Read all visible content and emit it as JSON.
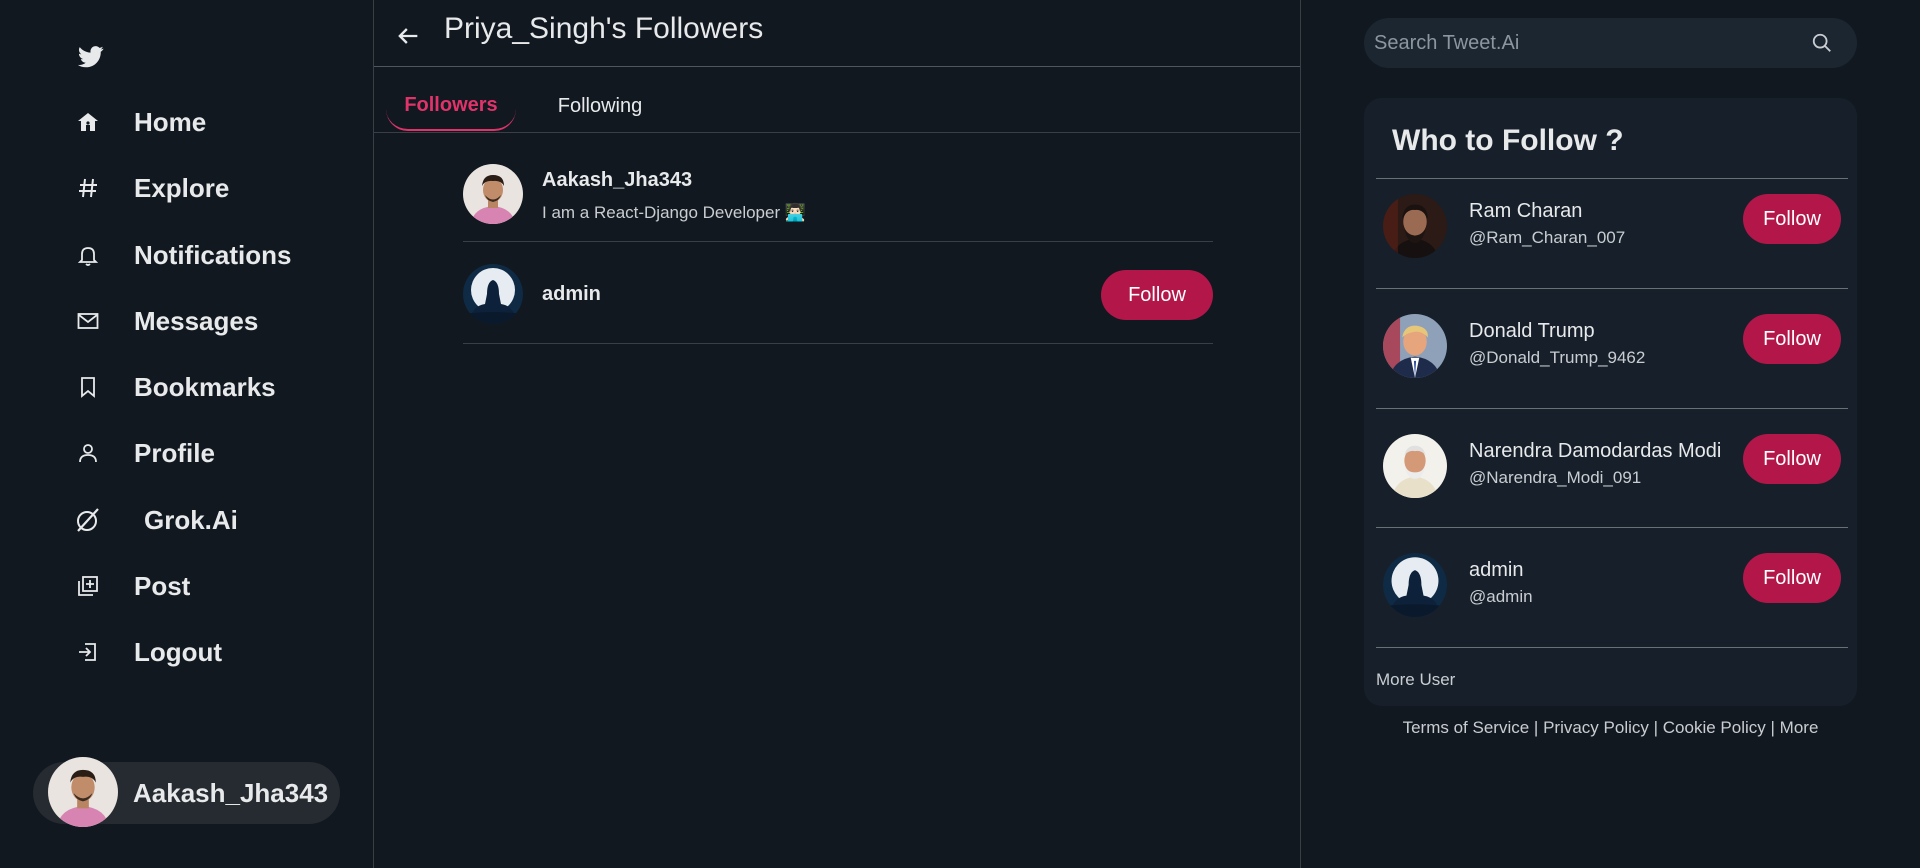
{
  "sidebar": {
    "nav": [
      {
        "label": "Home",
        "icon": "home-icon"
      },
      {
        "label": "Explore",
        "icon": "hashtag-icon"
      },
      {
        "label": "Notifications",
        "icon": "bell-icon"
      },
      {
        "label": "Messages",
        "icon": "envelope-icon"
      },
      {
        "label": "Bookmarks",
        "icon": "bookmark-icon"
      },
      {
        "label": "Profile",
        "icon": "user-icon"
      },
      {
        "label": "Grok.Ai",
        "icon": "grok-icon"
      },
      {
        "label": "Post",
        "icon": "add-post-icon"
      },
      {
        "label": "Logout",
        "icon": "logout-icon"
      }
    ],
    "current_user": "Aakash_Jha343"
  },
  "main": {
    "title": "Priya_Singh's Followers",
    "tabs": [
      {
        "label": "Followers",
        "active": true
      },
      {
        "label": "Following",
        "active": false
      }
    ],
    "followers": [
      {
        "name": "Aakash_Jha343",
        "bio": "I am a React-Django Developer 👨🏻‍💻",
        "button": ""
      },
      {
        "name": "admin",
        "bio": "",
        "button": "Follow"
      }
    ]
  },
  "right": {
    "search_placeholder": "Search Tweet.Ai",
    "who_to_follow": {
      "title": "Who to Follow ?",
      "users": [
        {
          "name": "Ram Charan",
          "handle": "@Ram_Charan_007",
          "button": "Follow"
        },
        {
          "name": "Donald Trump",
          "handle": "@Donald_Trump_9462",
          "button": "Follow"
        },
        {
          "name": "Narendra Damodardas Modi",
          "handle": "@Narendra_Modi_091",
          "button": "Follow"
        },
        {
          "name": "admin",
          "handle": "@admin",
          "button": "Follow"
        }
      ],
      "more": "More User"
    },
    "footer": {
      "terms": "Terms of Service",
      "privacy": "Privacy Policy",
      "cookie": "Cookie Policy",
      "more": "More",
      "separator": "|"
    }
  },
  "colors": {
    "background": "#111820",
    "accent": "#b3174a",
    "active_tab": "#e0336a",
    "card": "#17202a"
  }
}
